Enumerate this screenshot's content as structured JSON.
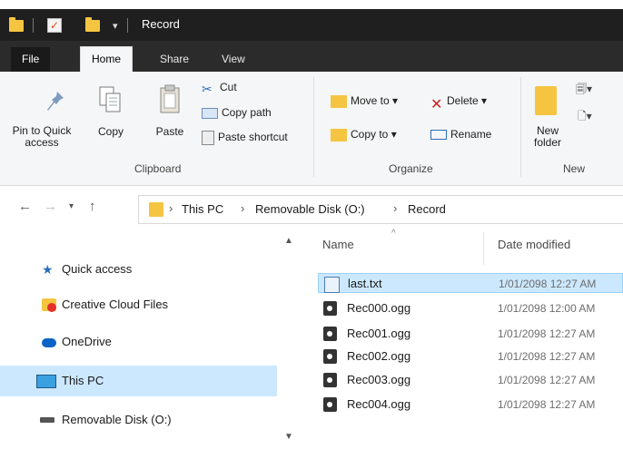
{
  "window": {
    "title": "Record"
  },
  "tabs": [
    {
      "label": "File"
    },
    {
      "label": "Home"
    },
    {
      "label": "Share"
    },
    {
      "label": "View"
    }
  ],
  "ribbon": {
    "clipboard": {
      "pin_label_1": "Pin to Quick",
      "pin_label_2": "access",
      "copy_label": "Copy",
      "paste_label": "Paste",
      "cut_label": "Cut",
      "copy_path_label": "Copy path",
      "paste_shortcut_label": "Paste shortcut",
      "group_label": "Clipboard"
    },
    "organize": {
      "move_to_label": "Move to ▾",
      "copy_to_label": "Copy to ▾",
      "delete_label": "Delete ▾",
      "rename_label": "Rename",
      "group_label": "Organize"
    },
    "new": {
      "new_folder_1": "New",
      "new_folder_2": "folder",
      "group_label": "New"
    }
  },
  "address": {
    "crumbs": [
      "This PC",
      "Removable Disk (O:)",
      "Record"
    ]
  },
  "sidebar": {
    "items": [
      {
        "label": "Quick access",
        "icon": "star-icon"
      },
      {
        "label": "Creative Cloud Files",
        "icon": "creative-cloud-icon"
      },
      {
        "label": "OneDrive",
        "icon": "cloud-icon"
      },
      {
        "label": "This PC",
        "icon": "monitor-icon"
      },
      {
        "label": "Removable Disk (O:)",
        "icon": "drive-icon"
      }
    ]
  },
  "columns": {
    "name": "Name",
    "date": "Date modified"
  },
  "files": [
    {
      "name": "last.txt",
      "date": "1/01/2098 12:27 AM",
      "icon": "text-file-icon"
    },
    {
      "name": "Rec000.ogg",
      "date": "1/01/2098 12:00 AM",
      "icon": "audio-file-icon"
    },
    {
      "name": "Rec001.ogg",
      "date": "1/01/2098 12:27 AM",
      "icon": "audio-file-icon"
    },
    {
      "name": "Rec002.ogg",
      "date": "1/01/2098 12:27 AM",
      "icon": "audio-file-icon"
    },
    {
      "name": "Rec003.ogg",
      "date": "1/01/2098 12:27 AM",
      "icon": "audio-file-icon"
    },
    {
      "name": "Rec004.ogg",
      "date": "1/01/2098 12:27 AM",
      "icon": "audio-file-icon"
    }
  ],
  "colors": {
    "selection": "#cce8ff",
    "folder": "#f5c542",
    "titlebar": "#1f1f1f"
  }
}
